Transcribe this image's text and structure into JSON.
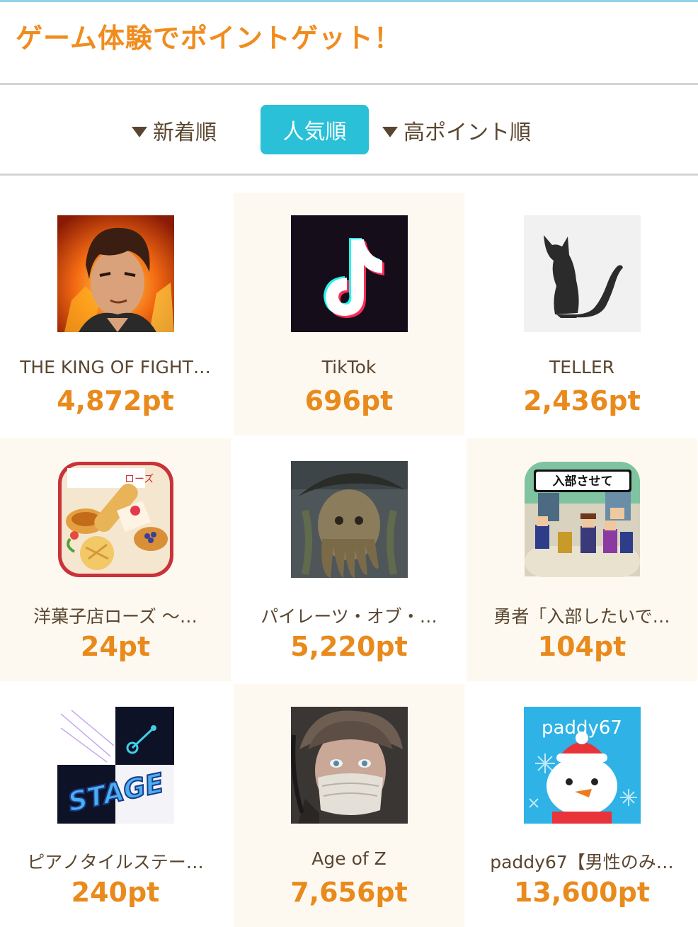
{
  "header": {
    "title": "ゲーム体験でポイントゲット！"
  },
  "sort": {
    "new_label": "新着順",
    "popular_label": "人気順",
    "high_label": "高ポイント順",
    "active": "人気順"
  },
  "apps": [
    {
      "name": "THE KING OF FIGHT…",
      "points": "4,872pt",
      "icon": "kof-fighter-icon"
    },
    {
      "name": "TikTok",
      "points": "696pt",
      "icon": "tiktok-note-icon"
    },
    {
      "name": "TELLER",
      "points": "2,436pt",
      "icon": "cat-silhouette-icon"
    },
    {
      "name": "洋菓子店ローズ 〜…",
      "points": "24pt",
      "icon": "pastry-shop-icon"
    },
    {
      "name": "パイレーツ・オブ・…",
      "points": "5,220pt",
      "icon": "pirate-captain-icon"
    },
    {
      "name": "勇者「入部したいで…",
      "points": "104pt",
      "icon": "pixel-heroes-icon"
    },
    {
      "name": "ピアノタイルステー…",
      "points": "240pt",
      "icon": "piano-tiles-stage-icon"
    },
    {
      "name": "Age of Z",
      "points": "7,656pt",
      "icon": "masked-soldier-icon"
    },
    {
      "name": "paddy67【男性のみ…",
      "points": "13,600pt",
      "icon": "snow-bear-icon"
    }
  ],
  "icon_texts": {
    "pastry_sign": "ローズ",
    "pixel_banner": "入部させて",
    "stage_word": "STAGE",
    "paddy_word": "paddy67"
  },
  "colors": {
    "accent_orange": "#f08c1e",
    "points_orange": "#e98a1c",
    "active_tab": "#29c0d8",
    "text_brown": "#5a4630",
    "cream_cell": "#fdf9f1"
  }
}
